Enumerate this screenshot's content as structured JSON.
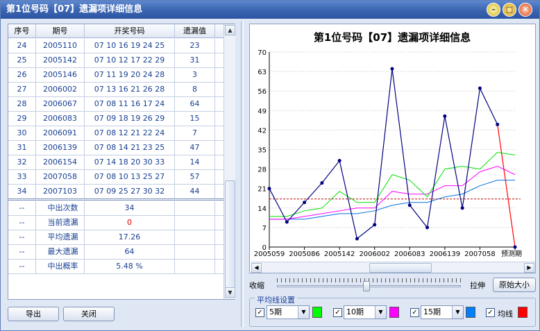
{
  "window": {
    "title": "第1位号码【07】遗漏项详细信息"
  },
  "table": {
    "headers": [
      "序号",
      "期号",
      "开奖号码",
      "遗漏值"
    ],
    "rows": [
      [
        "24",
        "2005110",
        "07 10 16 19 24 25",
        "23"
      ],
      [
        "25",
        "2005142",
        "07 10 12 17 22 29",
        "31"
      ],
      [
        "26",
        "2005146",
        "07 11 19 20 24 28",
        "3"
      ],
      [
        "27",
        "2006002",
        "07 13 16 21 26 28",
        "8"
      ],
      [
        "28",
        "2006067",
        "07 08 11 16 17 24",
        "64"
      ],
      [
        "29",
        "2006083",
        "07 09 18 19 26 29",
        "15"
      ],
      [
        "30",
        "2006091",
        "07 08 12 21 22 24",
        "7"
      ],
      [
        "31",
        "2006139",
        "07 08 14 21 23 25",
        "47"
      ],
      [
        "32",
        "2006154",
        "07 14 18 20 30 33",
        "14"
      ],
      [
        "33",
        "2007058",
        "07 08 10 13 25 27",
        "57"
      ],
      [
        "34",
        "2007103",
        "07 09 25 27 30 32",
        "44"
      ]
    ],
    "summary": [
      {
        "dash": "--",
        "label": "中出次数",
        "value": "34"
      },
      {
        "dash": "--",
        "label": "当前遗漏",
        "value": "0"
      },
      {
        "dash": "--",
        "label": "平均遗漏",
        "value": "17.26"
      },
      {
        "dash": "--",
        "label": "最大遗漏",
        "value": "64"
      },
      {
        "dash": "--",
        "label": "中出概率",
        "value": "5.48 %"
      }
    ]
  },
  "buttons": {
    "export": "导出",
    "close": "关闭",
    "reset_zoom": "原始大小"
  },
  "zoom": {
    "shrink_label": "收缩",
    "stretch_label": "拉伸"
  },
  "avg_settings": {
    "legend": "平均线设置",
    "items": [
      {
        "value": "5期",
        "checked": true,
        "color": "#00ff00"
      },
      {
        "value": "10期",
        "checked": true,
        "color": "#ff00ff"
      },
      {
        "value": "15期",
        "checked": true,
        "color": "#0080ff"
      }
    ],
    "mean_label": "均线",
    "mean_checked": true,
    "mean_color": "#ff0000"
  },
  "chart_data": {
    "type": "line",
    "title": "第1位号码【07】遗漏项详细信息",
    "ylim": [
      0,
      70
    ],
    "yticks": [
      0,
      7,
      14,
      21,
      28,
      35,
      42,
      49,
      56,
      63,
      70
    ],
    "x_tick_labels": [
      "2005059",
      "2005086",
      "2005142",
      "2006002",
      "2006083",
      "2006139",
      "2007058",
      "预测期"
    ],
    "grid": true,
    "mean_line": 17.26,
    "series": [
      {
        "color": "#000080",
        "markers": true,
        "values": [
          21,
          9,
          16,
          23,
          31,
          3,
          8,
          64,
          15,
          7,
          47,
          14,
          57,
          44,
          0
        ]
      },
      {
        "color": "#00e000",
        "values": [
          11,
          11,
          13,
          14,
          20,
          16,
          16,
          26,
          24,
          18,
          28,
          29,
          28,
          34,
          33
        ]
      },
      {
        "color": "#ff00ff",
        "values": [
          10,
          10,
          11,
          12,
          13,
          14,
          14,
          20,
          19,
          19,
          22,
          22,
          27,
          29,
          26
        ]
      },
      {
        "color": "#0070e0",
        "values": [
          10,
          10,
          10,
          11,
          12,
          12,
          13,
          15,
          16,
          16,
          18,
          19,
          22,
          24,
          24
        ]
      }
    ]
  }
}
